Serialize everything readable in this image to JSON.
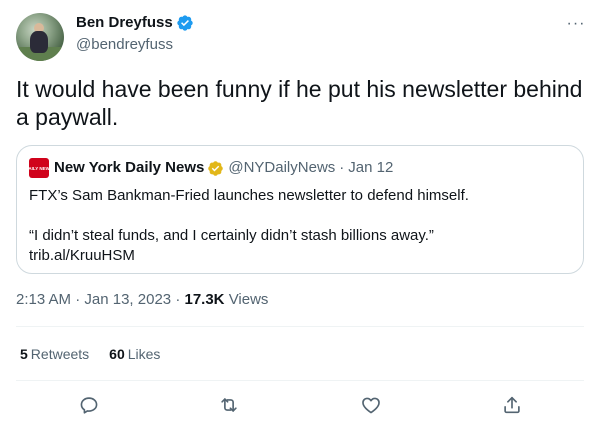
{
  "author": {
    "display_name": "Ben Dreyfuss",
    "handle": "@bendreyfuss",
    "verified": true
  },
  "more_label": "···",
  "tweet_text": "It would have been funny if he put his newsletter behind a paywall.",
  "quoted_tweet": {
    "logo_text": "DAILY NEWS",
    "display_name": "New York Daily News",
    "handle": "@NYDailyNews",
    "separator": "·",
    "date": "Jan 12",
    "line1": "FTX’s Sam Bankman-Fried launches newsletter to defend himself.",
    "line2": "“I didn’t steal funds, and I certainly didn’t stash billions away.”",
    "line3": "trib.al/KruuHSM"
  },
  "meta": {
    "time": "2:13 AM",
    "separator1": "·",
    "date": "Jan 13, 2023",
    "separator2": "·",
    "views_count": "17.3K",
    "views_label": "Views"
  },
  "stats": {
    "retweets_count": "5",
    "retweets_label": "Retweets",
    "likes_count": "60",
    "likes_label": "Likes"
  },
  "icons": [
    "reply-icon",
    "retweet-icon",
    "like-icon",
    "share-icon"
  ],
  "colors": {
    "verified_blue": "#1d9bf0",
    "gold_badge": "#e2b719",
    "secondary_text": "#536471",
    "nydn_red": "#d0021b"
  }
}
